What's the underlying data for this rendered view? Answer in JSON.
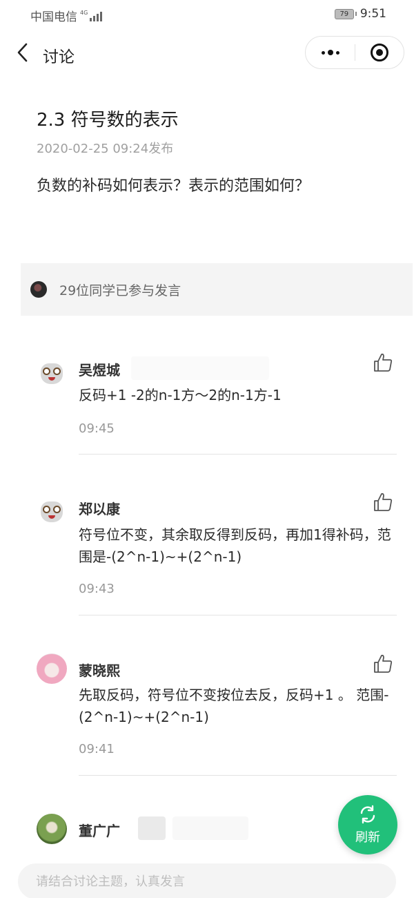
{
  "status_bar": {
    "carrier": "中国电信",
    "network": "4G",
    "battery": "79",
    "time": "9:51"
  },
  "nav": {
    "title": "讨论"
  },
  "topic": {
    "title": "2.3 符号数的表示",
    "date": "2020-02-25 09:24发布",
    "question": "负数的补码如何表示？表示的范围如何？"
  },
  "participants": {
    "text": "29位同学已参与发言"
  },
  "comments": [
    {
      "name": "吴煜城",
      "text": "反码+1 -2的n-1方～2的n-1方-1",
      "time": "09:45"
    },
    {
      "name": "郑以康",
      "text": "符号位不变，其余取反得到反码，再加1得补码，范围是-(2^n-1)~+(2^n-1)",
      "time": "09:43"
    },
    {
      "name": "蒙晓熙",
      "text": "先取反码，符号位不变按位去反，反码+1 。 范围-(2^n-1)~+(2^n-1)",
      "time": "09:41"
    },
    {
      "name": "董广广"
    }
  ],
  "refresh": {
    "label": "刷新"
  },
  "input": {
    "placeholder": "请结合讨论主题，认真发言"
  }
}
